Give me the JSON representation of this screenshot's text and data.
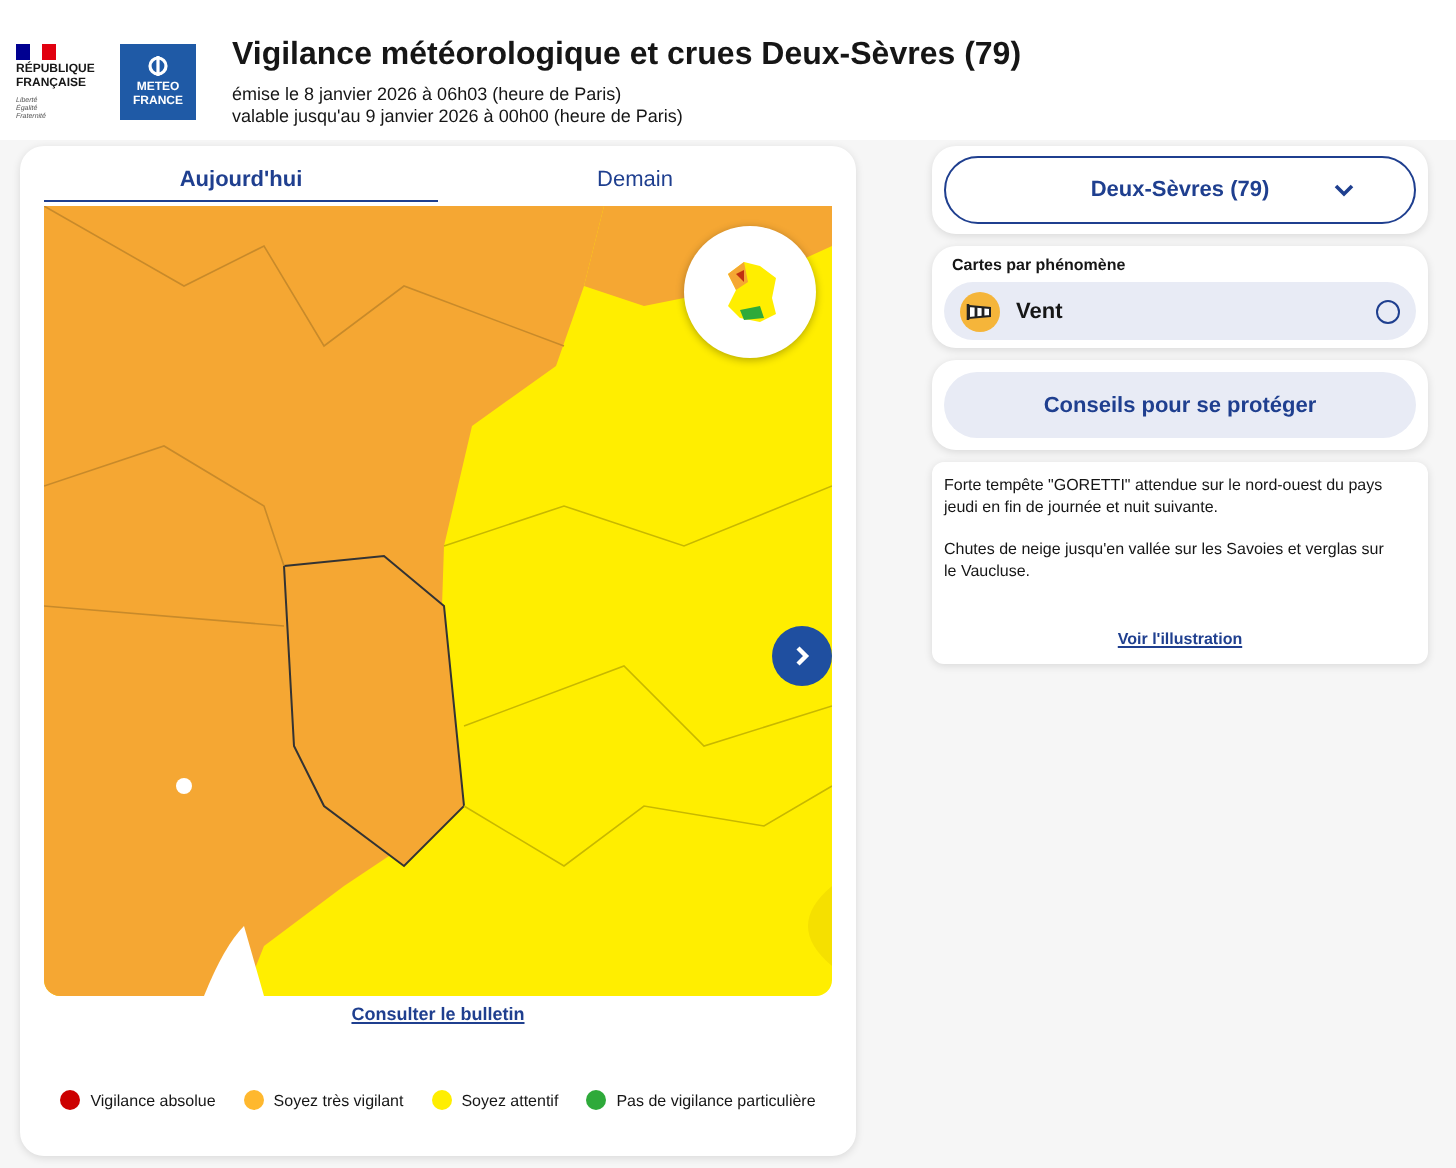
{
  "header": {
    "republic_logo": [
      "RÉPUBLIQUE",
      "FRANÇAISE"
    ],
    "republic_motto": [
      "Liberté",
      "Égalité",
      "Fraternité"
    ],
    "meteo_logo": [
      "METEO",
      "FRANCE"
    ],
    "title": "Vigilance météorologique et crues Deux-Sèvres (79)",
    "issued": "émise le 8 janvier 2026 à 06h03 (heure de Paris)",
    "valid": "valable jusqu'au 9 janvier 2026 à 00h00 (heure de Paris)"
  },
  "tabs": [
    {
      "label": "Aujourd'hui",
      "selected": true
    },
    {
      "label": "Demain",
      "selected": false
    }
  ],
  "map": {
    "kind": "picture"
  },
  "bulletin_link": "Consulter le bulletin",
  "legend": [
    {
      "label": "Vigilance absolue",
      "color": "#cc0000"
    },
    {
      "label": "Soyez très vigilant",
      "color": "#ffb82e"
    },
    {
      "label": "Soyez attentif",
      "color": "#ffee00"
    },
    {
      "label": "Pas de vigilance particulière",
      "color": "#2eaa3a"
    }
  ],
  "department_select": {
    "value": "Deux-Sèvres (79)"
  },
  "phenomena": {
    "title": "Cartes par phénomène",
    "items": [
      {
        "label": "Vent",
        "selected": false
      }
    ]
  },
  "advice_button": "Conseils pour se protéger",
  "bulletin_text": [
    "Forte tempête \"GORETTI\" attendue sur le nord-ouest du pays jeudi en fin de journée et nuit suivante.",
    "Chutes de neige jusqu'en vallée sur les Savoies et verglas sur le Vaucluse."
  ],
  "illustration_link": "Voir l'illustration"
}
